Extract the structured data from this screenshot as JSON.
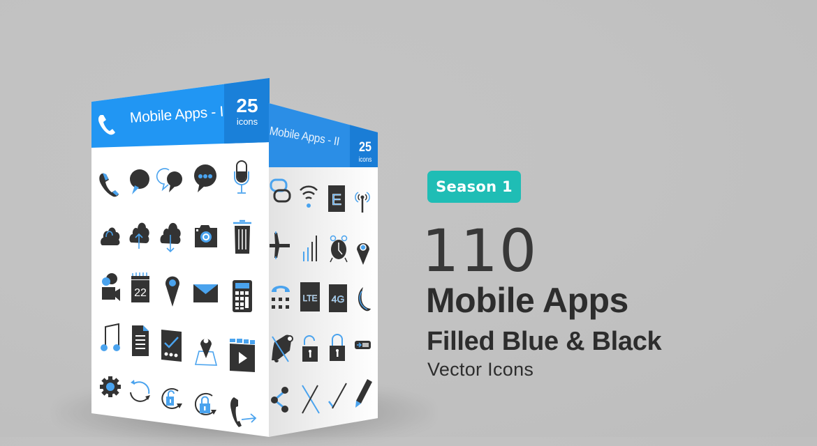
{
  "colors": {
    "background": "#c2c2c2",
    "header_blue": "#2196f3",
    "header_count_blue": "#1a80d9",
    "icon_dark": "#333333",
    "icon_blue": "#4aa3ee",
    "badge_teal": "#1fbdb5",
    "title_text": "#2d2d2d"
  },
  "box": {
    "front_panel": {
      "title": "Mobile Apps - I",
      "count": "25",
      "count_label": "icons",
      "header_icon": "phone-icon",
      "icons": [
        "phone-icon",
        "chat-bubble-icon",
        "chat-bubbles-icon",
        "chat-typing-icon",
        "microphone-icon",
        "cloud-icon",
        "cloud-upload-icon",
        "cloud-download-icon",
        "camera-icon",
        "trash-icon",
        "video-call-icon",
        "calendar-icon",
        "map-pin-icon",
        "mail-icon",
        "calculator-icon",
        "music-note-icon",
        "document-icon",
        "checklist-icon",
        "map-location-icon",
        "video-player-icon",
        "gear-icon",
        "refresh-icon",
        "rotate-unlock-icon",
        "rotate-lock-icon",
        "call-forward-icon"
      ],
      "calendar_day": "22"
    },
    "side_panel": {
      "title": "Mobile Apps - II",
      "count": "25",
      "count_label": "icons",
      "icons": [
        "link-icon",
        "wifi-icon",
        "edge-network-icon",
        "signal-tower-icon",
        "airplane-icon",
        "signal-bars-icon",
        "alarm-clock-icon",
        "location-pin-icon",
        "dialpad-icon",
        "lte-icon",
        "4g-icon",
        "moon-icon",
        "mute-bell-icon",
        "unlocked-padlock-icon",
        "padlock-icon",
        "battery-icon",
        "share-icon",
        "close-icon",
        "checkmark-icon",
        "pencil-icon"
      ],
      "labels": {
        "edge": "E",
        "lte": "LTE",
        "g4": "4G"
      }
    }
  },
  "promo": {
    "badge": "Season 1",
    "count": "110",
    "title": "Mobile Apps",
    "subtitle": "Filled Blue & Black",
    "tagline": "Vector Icons"
  }
}
